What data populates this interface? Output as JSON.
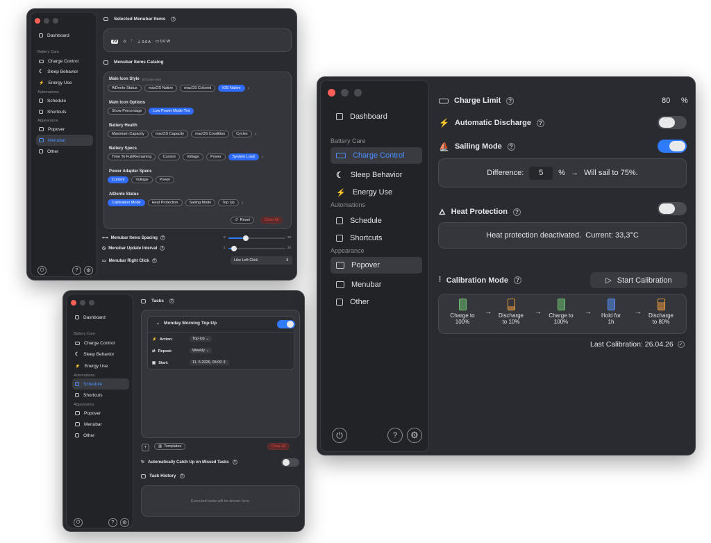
{
  "nav": {
    "dashboard": "Dashboard",
    "battery_care": "Battery Care",
    "charge_control": "Charge Control",
    "sleep_behavior": "Sleep Behavior",
    "energy_use": "Energy Use",
    "automations": "Automations",
    "schedule": "Schedule",
    "shortcuts": "Shortcuts",
    "appearance": "Appearance",
    "popover": "Popover",
    "menubar": "Menubar",
    "other": "Other"
  },
  "menubar_win": {
    "selected_title": "Selected Menubar Items",
    "preview_items": [
      "79",
      "",
      "",
      "0.0 A",
      "0.0 W"
    ],
    "catalog_title": "Menubar Items Catalog",
    "main_icon_style": "Main Icon Style",
    "choose_one": "(Choose one)",
    "style_chips": [
      "AlDente Status",
      "macOS Native",
      "macOS Colored",
      "iOS Native"
    ],
    "main_icon_options": "Main Icon Options",
    "option_chips": [
      "Show Percentage",
      "Low Power Mode Tint"
    ],
    "battery_health": "Battery Health",
    "health_chips": [
      "Maximum Capacity",
      "macOS Capacity",
      "macOS Condition",
      "Cycles"
    ],
    "battery_specs": "Battery Specs",
    "spec_chips": [
      "Time To Full/Remaining",
      "Current",
      "Voltage",
      "Power",
      "System Load"
    ],
    "power_adapter_specs": "Power Adapter Specs",
    "adapter_chips": [
      "Current",
      "Voltage",
      "Power"
    ],
    "aldente_status": "AlDente Status",
    "status_chips": [
      "Calibration Mode",
      "Heat Protection",
      "Sailing Mode",
      "Top Up"
    ],
    "reset": "Reset",
    "clear_all": "Clear All",
    "spacing_label": "Menubar Items Spacing",
    "spacing_min": "0",
    "spacing_max": "20",
    "spacing_value": 0.3,
    "interval_label": "Menubar Update Interval",
    "interval_min": "2",
    "interval_max": "20",
    "interval_value": 0.1,
    "right_click_label": "Menubar Right Click",
    "right_click_value": "Like Left Click"
  },
  "schedule_win": {
    "tasks_title": "Tasks",
    "task_name": "Monday Morning Top-Up",
    "action_label": "Action:",
    "action_value": "Top-Up",
    "repeat_label": "Repeat:",
    "repeat_value": "Weekly",
    "start_label": "Start:",
    "start_value": "11.  5.2026, 05:00",
    "templates": "Templates",
    "clear_all": "Clear All",
    "auto_catch_up": "Automatically Catch Up on Missed Tasks",
    "task_history": "Task History",
    "history_empty": "Executed tasks will be shown here."
  },
  "charge_win": {
    "charge_limit_label": "Charge Limit",
    "charge_limit_value": "80",
    "percent": "%",
    "auto_discharge": "Automatic Discharge",
    "sailing_mode": "Sailing Mode",
    "difference_label": "Difference:",
    "difference_value": "5",
    "sail_text": "Will sail to 75%.",
    "heat_protection": "Heat Protection",
    "heat_status": "Heat protection deactivated.  Current: 33,3°C",
    "calibration_mode": "Calibration Mode",
    "start_calibration": "Start Calibration",
    "steps": [
      {
        "line1": "Charge to",
        "line2": "100%",
        "color": "#6cc070"
      },
      {
        "line1": "Discharge",
        "line2": "to 10%",
        "color": "#e79a3c"
      },
      {
        "line1": "Charge to",
        "line2": "100%",
        "color": "#6cc070"
      },
      {
        "line1": "Hold for",
        "line2": "1h",
        "color": "#5a8df0"
      },
      {
        "line1": "Discharge",
        "line2": "to 80%",
        "color": "#e79a3c"
      }
    ],
    "last_calibration": "Last Calibration: 26.04.26"
  },
  "colors": {
    "accent": "#2f7bff",
    "danger": "#e0453a",
    "bg": "#2a2b30"
  }
}
